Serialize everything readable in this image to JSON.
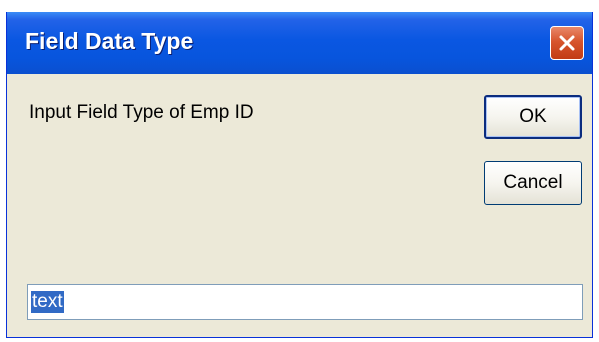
{
  "dialog": {
    "title": "Field Data Type",
    "prompt": "Input Field Type of Emp ID",
    "input_value": "text",
    "ok_label": "OK",
    "cancel_label": "Cancel"
  },
  "icons": {
    "close": "close-icon"
  },
  "colors": {
    "titlebar": "#0a57e2",
    "close_button": "#d7552d",
    "dialog_background": "#ece9d8",
    "selection": "#316ac5"
  }
}
